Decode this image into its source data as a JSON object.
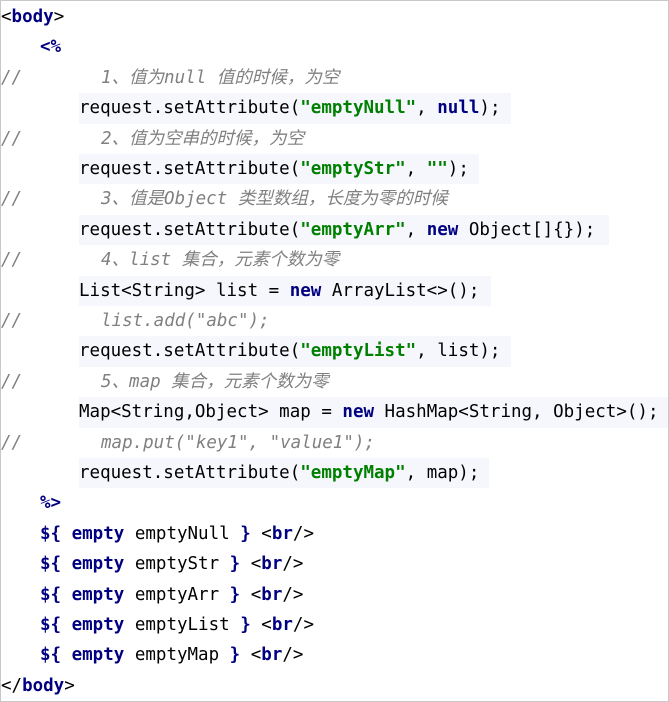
{
  "code": {
    "l01": {
      "a": "<",
      "b": "body",
      "c": ">"
    },
    "l02": {
      "a": "<%"
    },
    "l03": {
      "a": "//",
      "b": "1、值为null 值的时候，为空"
    },
    "l04": {
      "a": "request.setAttribute(",
      "b": "\"emptyNull\"",
      "c": ", ",
      "d": "null",
      "e": ");"
    },
    "l05": {
      "a": "//",
      "b": "2、值为空串的时候，为空"
    },
    "l06": {
      "a": "request.setAttribute(",
      "b": "\"emptyStr\"",
      "c": ", ",
      "d": "\"\"",
      "e": ");"
    },
    "l07": {
      "a": "//",
      "b": "3、值是Object 类型数组，长度为零的时候"
    },
    "l08": {
      "a": "request.setAttribute(",
      "b": "\"emptyArr\"",
      "c": ", ",
      "d": "new",
      "e": " Object[]{});"
    },
    "l09": {
      "a": "//",
      "b": "4、list 集合，元素个数为零"
    },
    "l10": {
      "a": "List<String> list = ",
      "b": "new",
      "c": " ArrayList<>();"
    },
    "l11": {
      "a": "//",
      "b": "list.add(\"abc\");"
    },
    "l12": {
      "a": "request.setAttribute(",
      "b": "\"emptyList\"",
      "c": ", list);"
    },
    "l13": {
      "a": "//",
      "b": "5、map 集合，元素个数为零"
    },
    "l14": {
      "a": "Map<String,Object> map = ",
      "b": "new",
      "c": " HashMap<String, Object>();"
    },
    "l15": {
      "a": "//",
      "b": "map.put(\"key1\", \"value1\");"
    },
    "l16": {
      "a": "request.setAttribute(",
      "b": "\"emptyMap\"",
      "c": ", map);"
    },
    "l17": {
      "a": "%>"
    },
    "l18": {
      "a": "${",
      "b": " empty",
      "c": " emptyNull ",
      "d": "}",
      "e": " <",
      "f": "br",
      "g": "/>"
    },
    "l19": {
      "a": "${",
      "b": " empty",
      "c": " emptyStr ",
      "d": "}",
      "e": " <",
      "f": "br",
      "g": "/>"
    },
    "l20": {
      "a": "${",
      "b": " empty",
      "c": " emptyArr ",
      "d": "}",
      "e": " <",
      "f": "br",
      "g": "/>"
    },
    "l21": {
      "a": "${",
      "b": " empty",
      "c": " emptyList ",
      "d": "}",
      "e": " <",
      "f": "br",
      "g": "/>"
    },
    "l22": {
      "a": "${",
      "b": " empty",
      "c": " emptyMap ",
      "d": "}",
      "e": " <",
      "f": "br",
      "g": "/>"
    },
    "l23": {
      "a": "</",
      "b": "body",
      "c": ">"
    }
  }
}
